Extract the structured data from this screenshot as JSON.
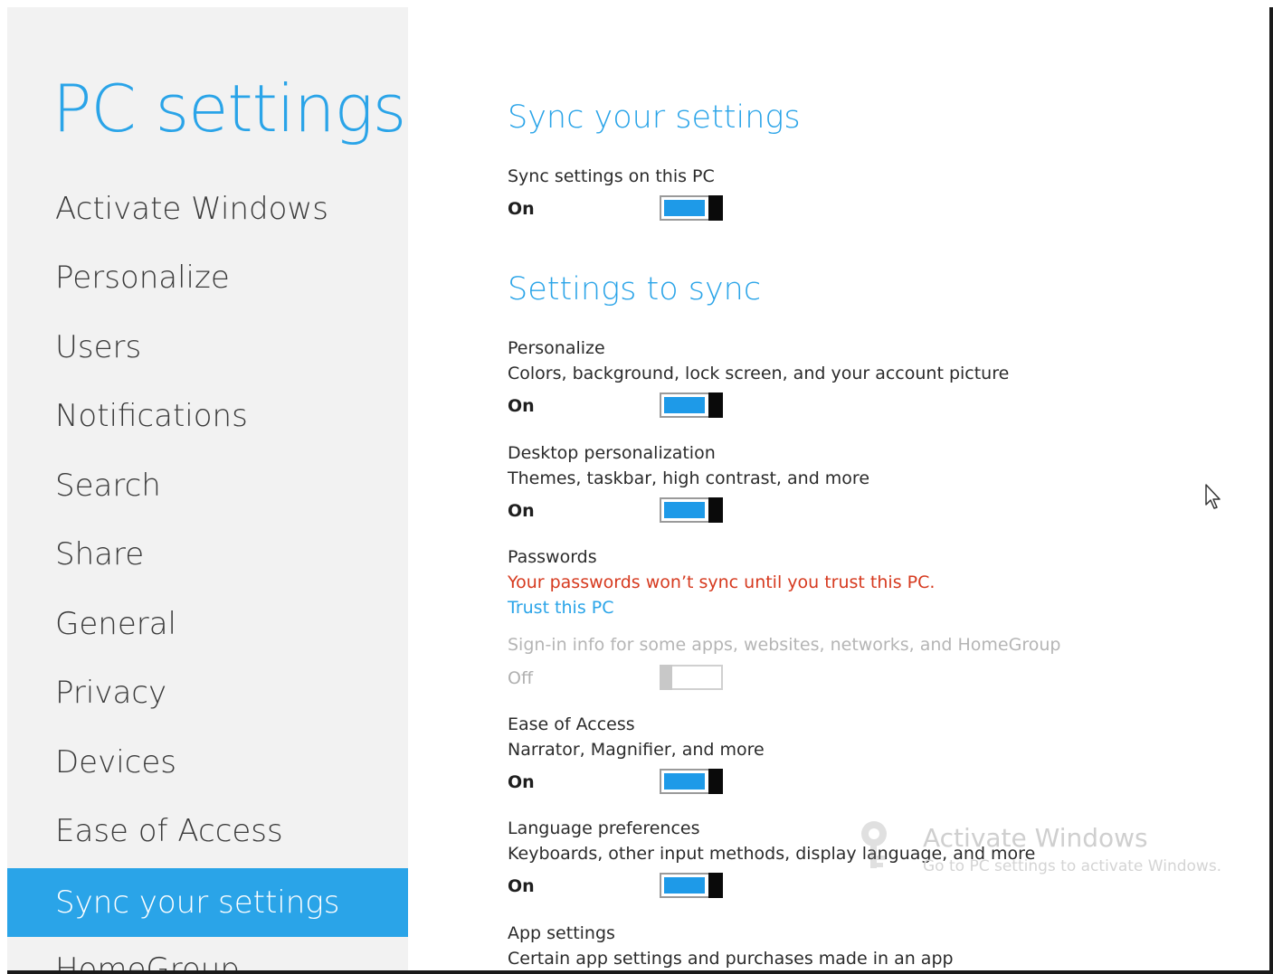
{
  "sidebar": {
    "title": "PC settings",
    "items": [
      {
        "label": "Activate Windows"
      },
      {
        "label": "Personalize"
      },
      {
        "label": "Users"
      },
      {
        "label": "Notifications"
      },
      {
        "label": "Search"
      },
      {
        "label": "Share"
      },
      {
        "label": "General"
      },
      {
        "label": "Privacy"
      },
      {
        "label": "Devices"
      },
      {
        "label": "Ease of Access"
      },
      {
        "label": "Sync your settings",
        "selected": true
      },
      {
        "label": "HomeGroup"
      }
    ]
  },
  "main": {
    "sync_heading": "Sync your settings",
    "sync_pc": {
      "label": "Sync settings on this PC",
      "state": "On",
      "on": true
    },
    "settings_heading": "Settings to sync",
    "personalize": {
      "label": "Personalize",
      "desc": "Colors, background, lock screen, and your account picture",
      "state": "On",
      "on": true
    },
    "desktop": {
      "label": "Desktop personalization",
      "desc": "Themes, taskbar, high contrast, and more",
      "state": "On",
      "on": true
    },
    "passwords": {
      "label": "Passwords",
      "warning": "Your passwords won’t sync until you trust this PC.",
      "link": "Trust this PC",
      "desc": "Sign-in info for some apps, websites, networks, and HomeGroup",
      "state": "Off",
      "on": false
    },
    "ease": {
      "label": "Ease of Access",
      "desc": "Narrator, Magnifier, and more",
      "state": "On",
      "on": true
    },
    "language": {
      "label": "Language preferences",
      "desc": "Keyboards, other input methods, display language, and more",
      "state": "On",
      "on": true
    },
    "apps": {
      "label": "App settings",
      "desc": "Certain app settings and purchases made in an app"
    }
  },
  "watermark": {
    "title": "Activate Windows",
    "subtitle": "Go to PC settings to activate Windows."
  },
  "colors": {
    "accent": "#2aa4e8",
    "toggle_fill": "#1e9ae8",
    "warning": "#d63a1f"
  }
}
